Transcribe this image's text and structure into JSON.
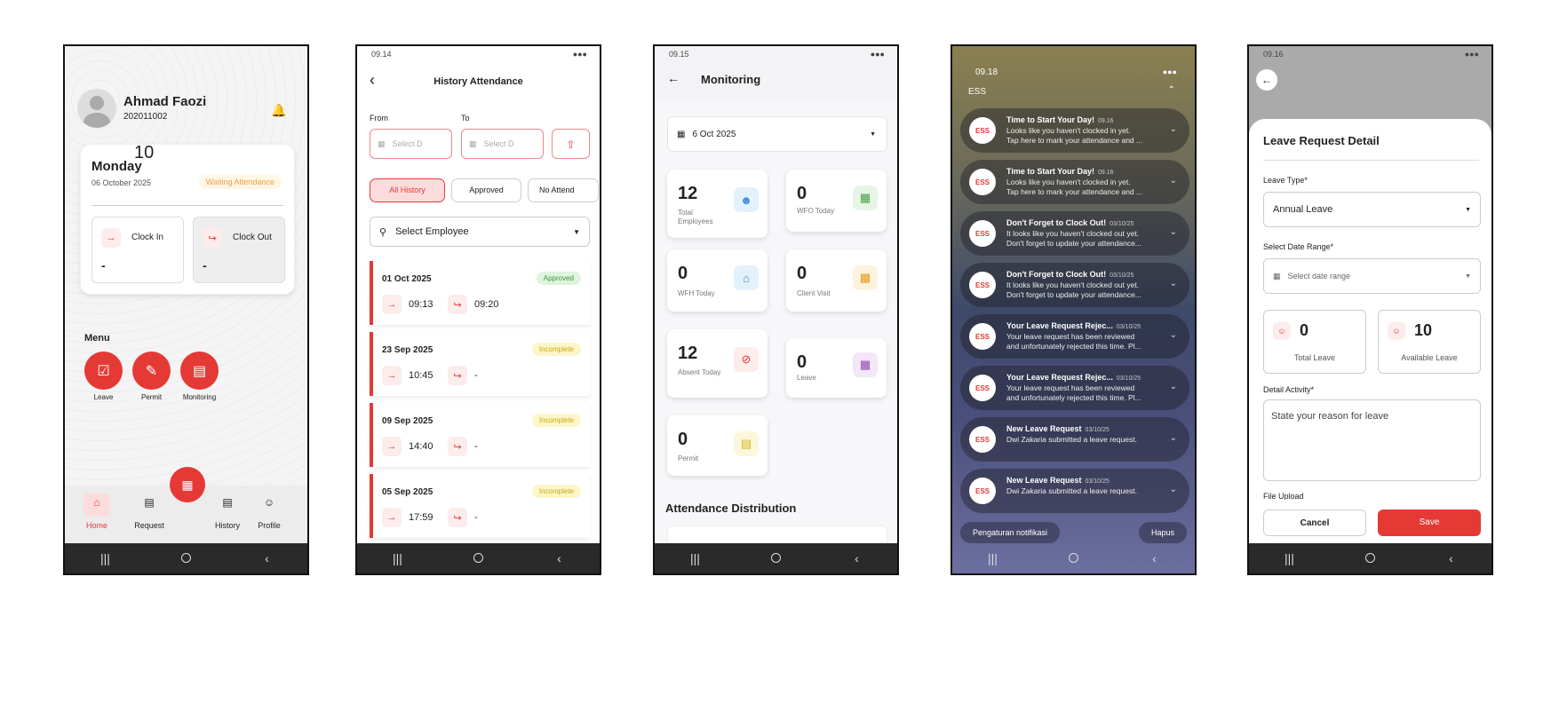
{
  "phone1": {
    "user_name": "Ahmad Faozi",
    "user_id": "202011002",
    "day_num": "10",
    "day_name": "Monday",
    "date": "06 October 2025",
    "status_badge": "Waiting Attendance",
    "clock_in_label": "Clock In",
    "clock_in_value": "-",
    "clock_out_label": "Clock Out",
    "clock_out_value": "-",
    "menu_title": "Menu",
    "menu": [
      {
        "label": "Leave"
      },
      {
        "label": "Permit"
      },
      {
        "label": "Monitoring"
      }
    ],
    "bottom_nav": [
      {
        "label": "Home"
      },
      {
        "label": "Request"
      },
      {
        "label": "History"
      },
      {
        "label": "Profile"
      }
    ]
  },
  "phone2": {
    "status_time": "09.14",
    "title": "History Attendance",
    "from_label": "From",
    "to_label": "To",
    "from_placeholder": "Select D",
    "to_placeholder": "Select D",
    "filters": [
      {
        "label": "All History"
      },
      {
        "label": "Approved"
      },
      {
        "label": "No Attend"
      }
    ],
    "employee_placeholder": "Select Employee",
    "records": [
      {
        "date": "01 Oct 2025",
        "status": "Approved",
        "in": "09:13",
        "out": "09:20"
      },
      {
        "date": "23 Sep 2025",
        "status": "Incomplete",
        "in": "10:45",
        "out": "-"
      },
      {
        "date": "09 Sep 2025",
        "status": "Incomplete",
        "in": "14:40",
        "out": "-"
      },
      {
        "date": "05 Sep 2025",
        "status": "Incomplete",
        "in": "17:59",
        "out": "-"
      }
    ]
  },
  "phone3": {
    "status_time": "09.15",
    "title": "Monitoring",
    "date_value": "6 Oct 2025",
    "cards": [
      {
        "num": "12",
        "label": "Total Employees",
        "icon": "people-icon",
        "color": "#3b8fd4",
        "bg": "#e3f1fb"
      },
      {
        "num": "0",
        "label": "WFO Today",
        "icon": "building-icon",
        "color": "#43a047",
        "bg": "#e6f5e6"
      },
      {
        "num": "0",
        "label": "WFH Today",
        "icon": "home-icon",
        "color": "#3b8fd4",
        "bg": "#e3f1fb"
      },
      {
        "num": "0",
        "label": "Client Visit",
        "icon": "briefcase-icon",
        "color": "#e69a1e",
        "bg": "#fdf2de"
      },
      {
        "num": "12",
        "label": "Absent Today",
        "icon": "no-user-icon",
        "color": "#e53935",
        "bg": "#fdecec"
      },
      {
        "num": "0",
        "label": "Leave",
        "icon": "calendar-icon",
        "color": "#8e44ad",
        "bg": "#f3e6f8"
      },
      {
        "num": "0",
        "label": "Permit",
        "icon": "document-icon",
        "color": "#d4b21a",
        "bg": "#fcf7dc"
      }
    ],
    "section_title": "Attendance Distribution"
  },
  "phone4": {
    "status_time": "09.18",
    "app_label": "ESS",
    "notifications": [
      {
        "title": "Time to Start Your Day!",
        "time": "09.16",
        "body": "Looks like you haven't clocked in yet.\nTap here to mark your attendance and ..."
      },
      {
        "title": "Time to Start Your Day!",
        "time": "09.16",
        "body": "Looks like you haven't clocked in yet.\nTap here to mark your attendance and ..."
      },
      {
        "title": "Don't Forget to Clock Out!",
        "time": "03/10/25",
        "body": "It looks like you haven't clocked out yet.\nDon't forget to update your attendance..."
      },
      {
        "title": "Don't Forget to Clock Out!",
        "time": "03/10/25",
        "body": "It looks like you haven't clocked out yet.\nDon't forget to update your attendance..."
      },
      {
        "title": "Your Leave Request Rejec...",
        "time": "03/10/25",
        "body": "Your leave request has been reviewed\nand unfortunately rejected this time. Pl..."
      },
      {
        "title": "Your Leave Request Rejec...",
        "time": "03/10/25",
        "body": "Your leave request has been reviewed\nand unfortunately rejected this time. Pl..."
      },
      {
        "title": "New Leave Request",
        "time": "03/10/25",
        "body": "Dwi Zakaria submitted a leave request."
      },
      {
        "title": "New Leave Request",
        "time": "03/10/25",
        "body": "Dwi Zakaria submitted a leave request."
      }
    ],
    "settings_label": "Pengaturan notifikasi",
    "clear_label": "Hapus"
  },
  "phone5": {
    "status_time": "09.16",
    "title": "Leave Request Detail",
    "leave_type_label": "Leave Type*",
    "leave_type_value": "Annual Leave",
    "date_range_label": "Select Date Range*",
    "date_range_placeholder": "Select date range",
    "total_leave_num": "0",
    "total_leave_label": "Total Leave",
    "available_leave_num": "10",
    "available_leave_label": "Available Leave",
    "detail_label": "Detail Activity*",
    "detail_placeholder": "State your reason for leave",
    "file_upload_label": "File Upload",
    "cancel_label": "Cancel",
    "save_label": "Save"
  }
}
